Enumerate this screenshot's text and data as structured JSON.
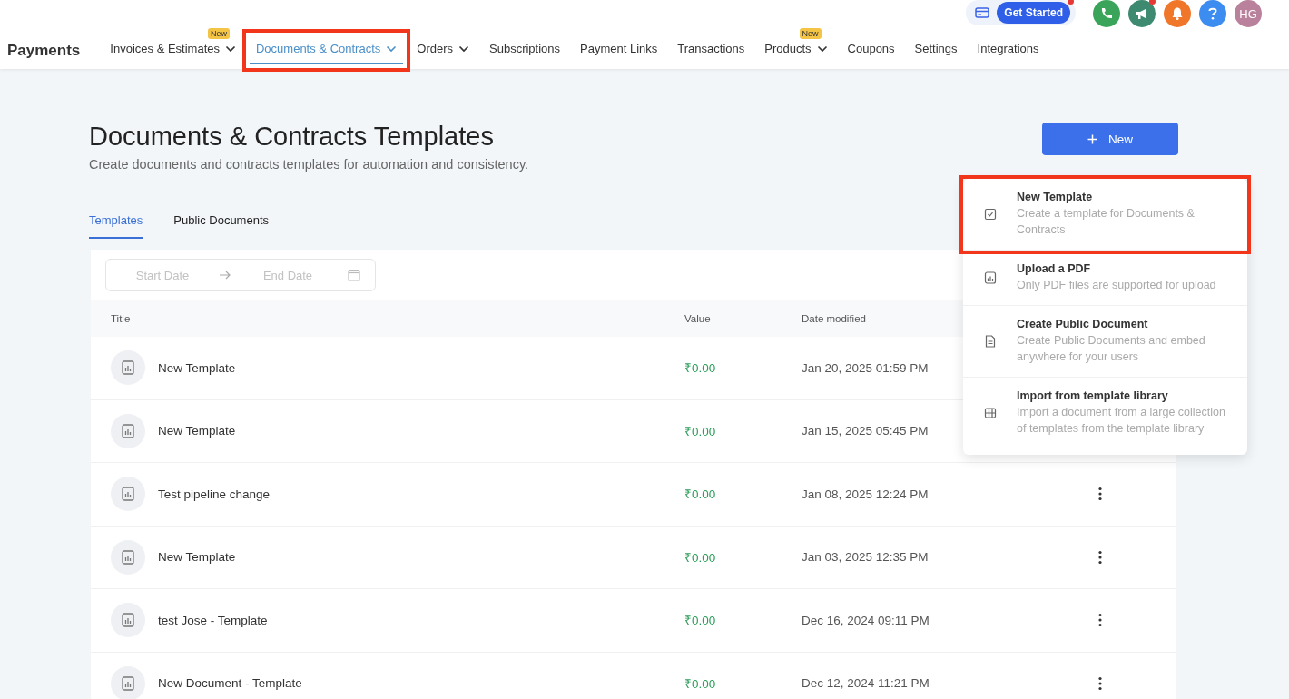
{
  "header": {
    "get_started": "Get Started",
    "avatar": "HG"
  },
  "nav": {
    "brand": "Payments",
    "items": [
      {
        "label": "Invoices & Estimates",
        "selected": false,
        "caret": true,
        "badge": "New"
      },
      {
        "label": "Documents & Contracts",
        "selected": true,
        "caret": true,
        "annotated": true
      },
      {
        "label": "Orders",
        "selected": false,
        "caret": true
      },
      {
        "label": "Subscriptions",
        "selected": false,
        "caret": false
      },
      {
        "label": "Payment Links",
        "selected": false,
        "caret": false
      },
      {
        "label": "Transactions",
        "selected": false,
        "caret": false
      },
      {
        "label": "Products",
        "selected": false,
        "caret": true,
        "badge": "New"
      },
      {
        "label": "Coupons",
        "selected": false,
        "caret": false
      },
      {
        "label": "Settings",
        "selected": false,
        "caret": false
      },
      {
        "label": "Integrations",
        "selected": false,
        "caret": false
      }
    ]
  },
  "page": {
    "title": "Documents & Contracts Templates",
    "subtitle": "Create documents and contracts templates for automation and consistency.",
    "new_button": "New"
  },
  "tabs": [
    {
      "label": "Templates",
      "selected": true
    },
    {
      "label": "Public Documents",
      "selected": false
    }
  ],
  "filter": {
    "start_placeholder": "Start Date",
    "end_placeholder": "End Date"
  },
  "table": {
    "columns": [
      "Title",
      "Value",
      "Date modified"
    ],
    "rows": [
      {
        "title": "New Template",
        "value": "₹0.00",
        "date": "Jan 20, 2025 01:59 PM"
      },
      {
        "title": "New Template",
        "value": "₹0.00",
        "date": "Jan 15, 2025 05:45 PM"
      },
      {
        "title": "Test pipeline change",
        "value": "₹0.00",
        "date": "Jan 08, 2025 12:24 PM",
        "more_button": true
      },
      {
        "title": "New Template",
        "value": "₹0.00",
        "date": "Jan 03, 2025 12:35 PM",
        "more_button": true
      },
      {
        "title": "test Jose - Template",
        "value": "₹0.00",
        "date": "Dec 16, 2024 09:11 PM",
        "more_button": true
      },
      {
        "title": "New Document - Template",
        "value": "₹0.00",
        "date": "Dec 12, 2024 11:21 PM",
        "more_button": true
      }
    ]
  },
  "menu": {
    "items": [
      {
        "kind": "template",
        "title": "New Template",
        "description": "Create a template for Documents & Contracts",
        "annotated": true
      },
      {
        "kind": "pdf",
        "title": "Upload a PDF",
        "description": "Only PDF files are supported for upload"
      },
      {
        "kind": "public",
        "title": "Create Public Document",
        "description": "Create Public Documents and embed anywhere for your users"
      },
      {
        "kind": "library",
        "title": "Import from template library",
        "description": "Import a document from a large collection of templates from the template library"
      }
    ]
  }
}
